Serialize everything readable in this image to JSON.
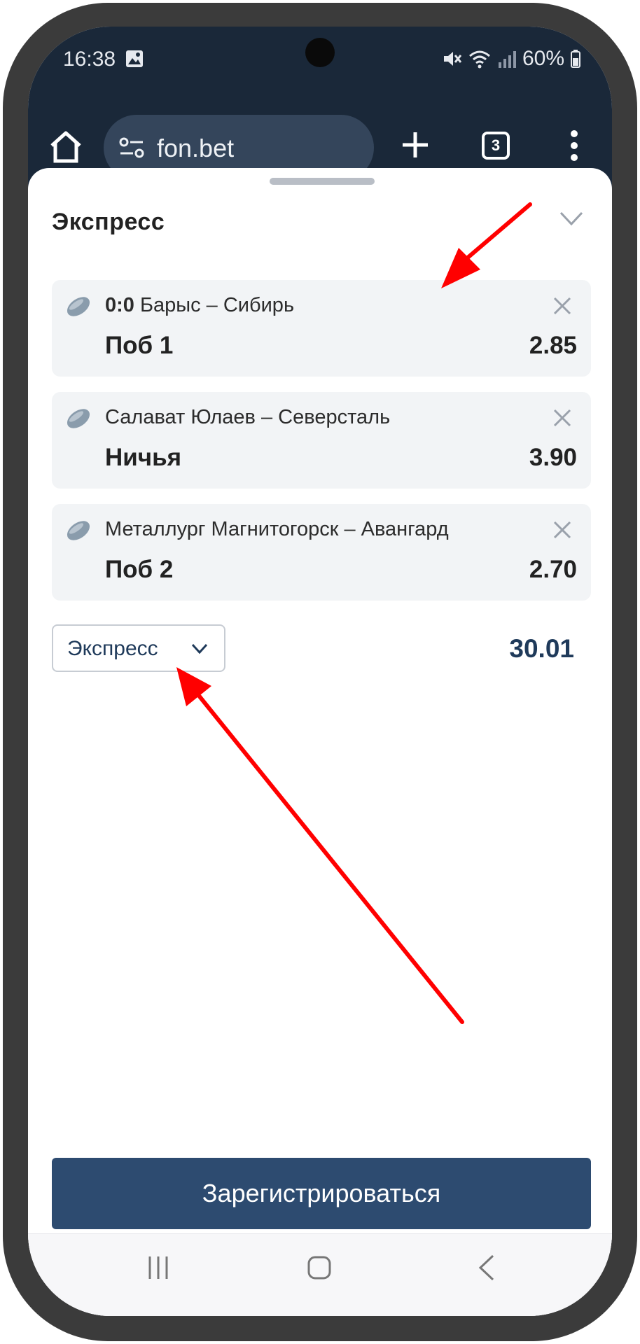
{
  "status_bar": {
    "time": "16:38",
    "battery": "60%",
    "icons": [
      "gallery-icon",
      "mute-icon",
      "wifi-icon",
      "signal-icon",
      "battery-icon"
    ]
  },
  "browser": {
    "url": "fon.bet",
    "tab_count": "3",
    "icons": [
      "home-icon",
      "site-settings-icon",
      "new-tab-icon",
      "tabs-icon",
      "menu-icon"
    ]
  },
  "bet_slip": {
    "title": "Экспресс",
    "bets": [
      {
        "score": "0:0",
        "match": "Барыс – Сибирь",
        "outcome": "Поб 1",
        "odds": "2.85"
      },
      {
        "score": "",
        "match": "Салават Юлаев – Северсталь",
        "outcome": "Ничья",
        "odds": "3.90"
      },
      {
        "score": "",
        "match": "Металлург Магнитогорск – Авангард",
        "outcome": "Поб 2",
        "odds": "2.70"
      }
    ],
    "bet_type": "Экспресс",
    "total_odds": "30.01",
    "register_label": "Зарегистрироваться"
  },
  "colors": {
    "browser_bar": "#1a2839",
    "url_bar": "#34455b",
    "card_bg": "#f2f4f6",
    "primary": "#2d4b70",
    "accent_text": "#1f3a5a",
    "annotation_arrow": "#ff0000"
  }
}
